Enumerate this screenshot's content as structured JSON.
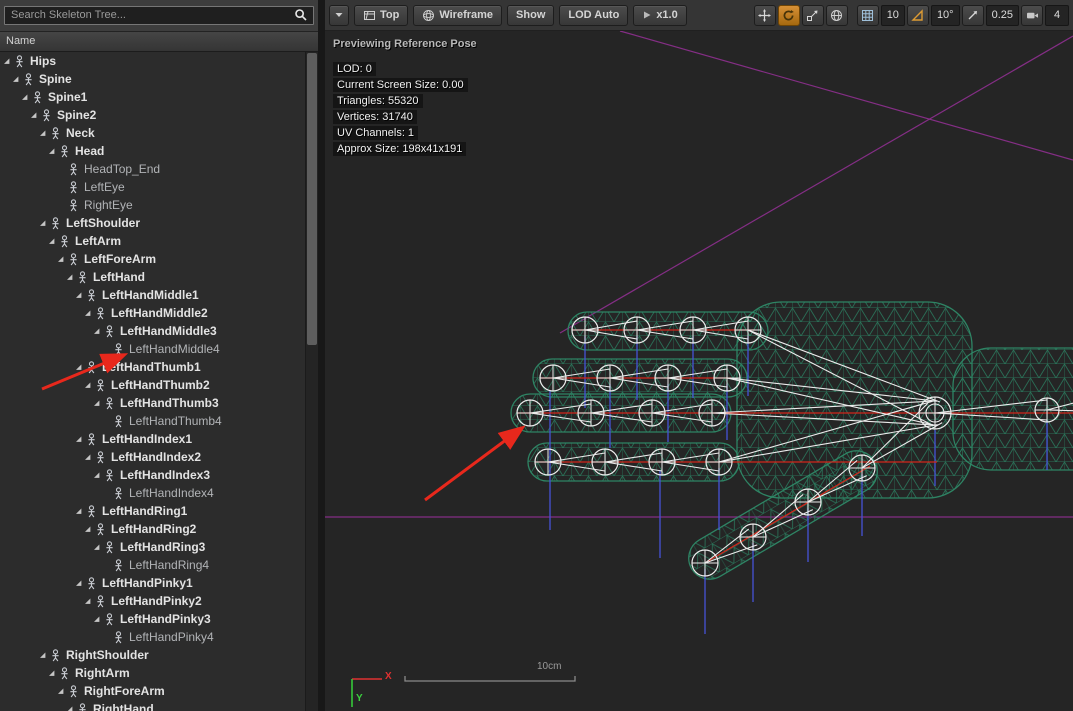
{
  "colors": {
    "accent_orange": "#c07a23",
    "wireframe_green": "#2f8a68",
    "bone_white": "#ededed",
    "axis_red": "#d2261b",
    "axis_blue": "#4553d6",
    "grid_magenta": "#8f2f90",
    "annotation_red": "#e8281c"
  },
  "skeleton_tree": {
    "search_placeholder": "Search Skeleton Tree...",
    "column_header": "Name",
    "bones": [
      {
        "name": "Hips",
        "depth": 0,
        "bold": true,
        "expandable": true
      },
      {
        "name": "Spine",
        "depth": 1,
        "bold": true,
        "expandable": true
      },
      {
        "name": "Spine1",
        "depth": 2,
        "bold": true,
        "expandable": true
      },
      {
        "name": "Spine2",
        "depth": 3,
        "bold": true,
        "expandable": true
      },
      {
        "name": "Neck",
        "depth": 4,
        "bold": true,
        "expandable": true
      },
      {
        "name": "Head",
        "depth": 5,
        "bold": true,
        "expandable": true
      },
      {
        "name": "HeadTop_End",
        "depth": 6,
        "bold": false,
        "expandable": false
      },
      {
        "name": "LeftEye",
        "depth": 6,
        "bold": false,
        "expandable": false
      },
      {
        "name": "RightEye",
        "depth": 6,
        "bold": false,
        "expandable": false
      },
      {
        "name": "LeftShoulder",
        "depth": 4,
        "bold": true,
        "expandable": true
      },
      {
        "name": "LeftArm",
        "depth": 5,
        "bold": true,
        "expandable": true
      },
      {
        "name": "LeftForeArm",
        "depth": 6,
        "bold": true,
        "expandable": true
      },
      {
        "name": "LeftHand",
        "depth": 7,
        "bold": true,
        "expandable": true
      },
      {
        "name": "LeftHandMiddle1",
        "depth": 8,
        "bold": true,
        "expandable": true
      },
      {
        "name": "LeftHandMiddle2",
        "depth": 9,
        "bold": true,
        "expandable": true
      },
      {
        "name": "LeftHandMiddle3",
        "depth": 10,
        "bold": true,
        "expandable": true
      },
      {
        "name": "LeftHandMiddle4",
        "depth": 11,
        "bold": false,
        "expandable": false
      },
      {
        "name": "LeftHandThumb1",
        "depth": 8,
        "bold": true,
        "expandable": true
      },
      {
        "name": "LeftHandThumb2",
        "depth": 9,
        "bold": true,
        "expandable": true
      },
      {
        "name": "LeftHandThumb3",
        "depth": 10,
        "bold": true,
        "expandable": true
      },
      {
        "name": "LeftHandThumb4",
        "depth": 11,
        "bold": false,
        "expandable": false
      },
      {
        "name": "LeftHandIndex1",
        "depth": 8,
        "bold": true,
        "expandable": true
      },
      {
        "name": "LeftHandIndex2",
        "depth": 9,
        "bold": true,
        "expandable": true
      },
      {
        "name": "LeftHandIndex3",
        "depth": 10,
        "bold": true,
        "expandable": true
      },
      {
        "name": "LeftHandIndex4",
        "depth": 11,
        "bold": false,
        "expandable": false
      },
      {
        "name": "LeftHandRing1",
        "depth": 8,
        "bold": true,
        "expandable": true
      },
      {
        "name": "LeftHandRing2",
        "depth": 9,
        "bold": true,
        "expandable": true
      },
      {
        "name": "LeftHandRing3",
        "depth": 10,
        "bold": true,
        "expandable": true
      },
      {
        "name": "LeftHandRing4",
        "depth": 11,
        "bold": false,
        "expandable": false
      },
      {
        "name": "LeftHandPinky1",
        "depth": 8,
        "bold": true,
        "expandable": true
      },
      {
        "name": "LeftHandPinky2",
        "depth": 9,
        "bold": true,
        "expandable": true
      },
      {
        "name": "LeftHandPinky3",
        "depth": 10,
        "bold": true,
        "expandable": true
      },
      {
        "name": "LeftHandPinky4",
        "depth": 11,
        "bold": false,
        "expandable": false
      },
      {
        "name": "RightShoulder",
        "depth": 4,
        "bold": true,
        "expandable": true
      },
      {
        "name": "RightArm",
        "depth": 5,
        "bold": true,
        "expandable": true
      },
      {
        "name": "RightForeArm",
        "depth": 6,
        "bold": true,
        "expandable": true
      },
      {
        "name": "RightHand",
        "depth": 7,
        "bold": true,
        "expandable": true
      }
    ]
  },
  "viewport_toolbar": {
    "view_mode": "Top",
    "shading": "Wireframe",
    "show": "Show",
    "lod": "LOD Auto",
    "playback_speed": "x1.0",
    "grid_snap": "10",
    "rotation_snap": "10°",
    "scale_snap": "0.25",
    "camera_speed": "4"
  },
  "viewport": {
    "preview_label": "Previewing Reference Pose",
    "stats": [
      "LOD: 0",
      "Current Screen Size: 0.00",
      "Triangles: 55320",
      "Vertices: 31740",
      "UV Channels: 1",
      "Approx Size: 198x41x191"
    ],
    "scale_bar_label": "10cm",
    "axis_x_label": "X",
    "axis_y_label": "Y"
  }
}
